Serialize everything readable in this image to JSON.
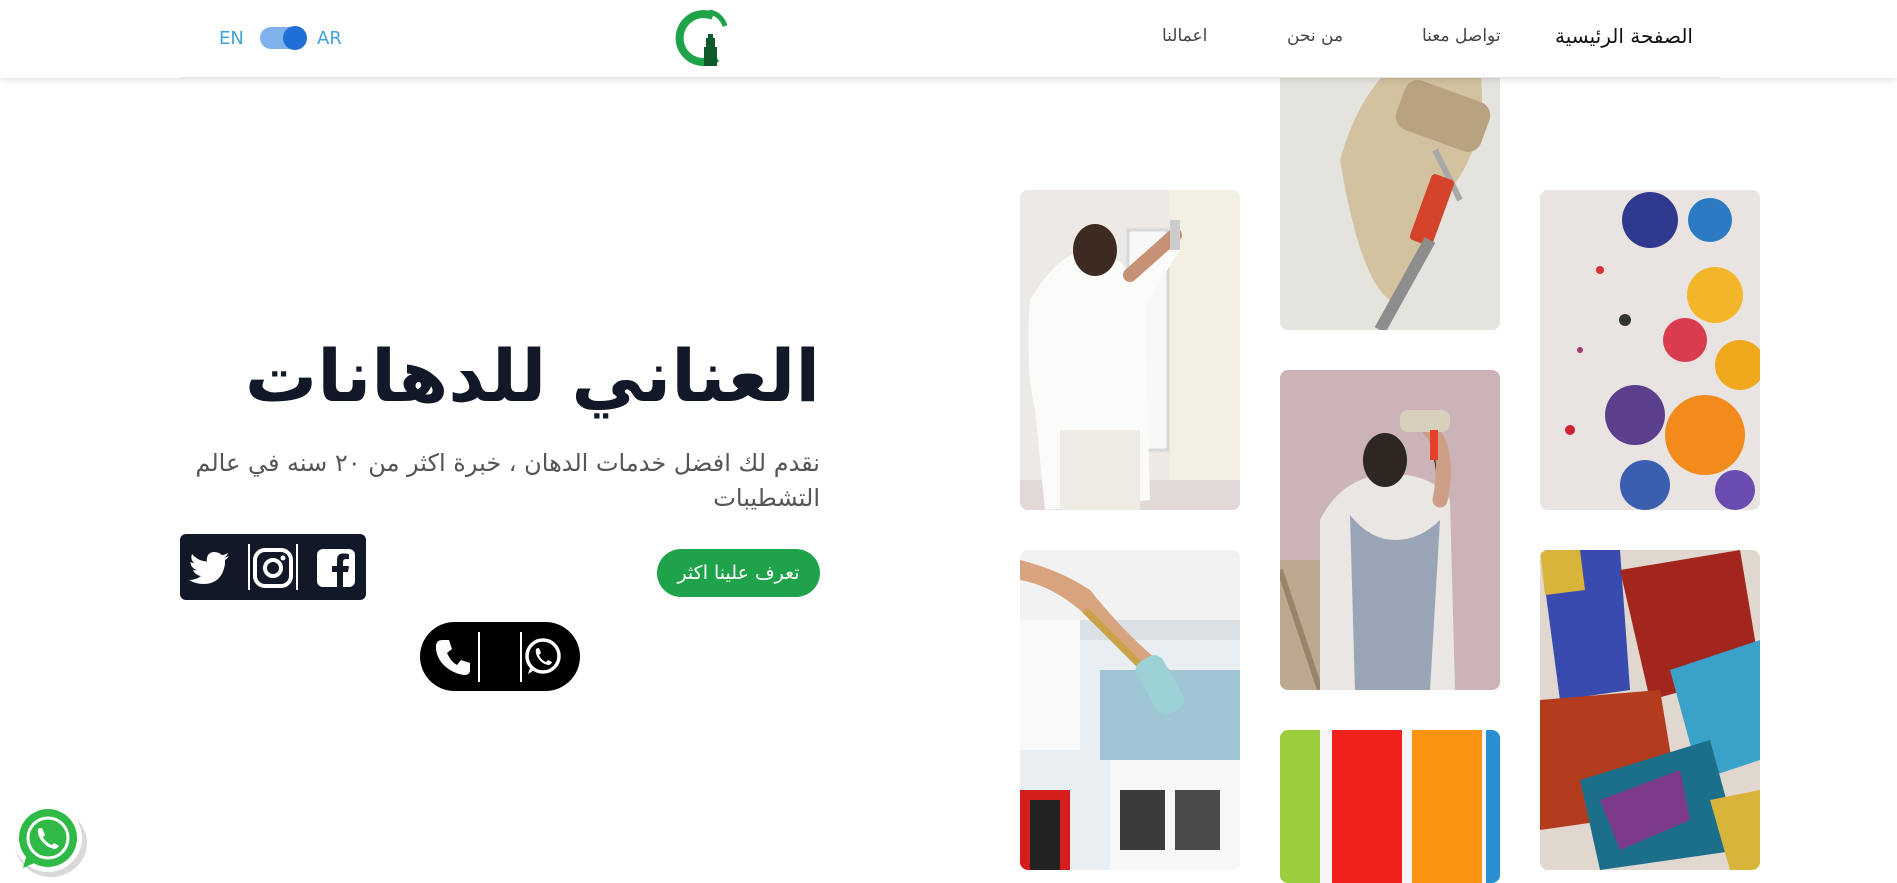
{
  "header": {
    "nav": [
      "الصفحة الرئيسية",
      "تواصل معنا",
      "من نحن",
      "اعمالنا"
    ],
    "lang_left": "EN",
    "lang_right": "AR"
  },
  "hero": {
    "title": "العناني للدهانات",
    "subtitle": "نقدم لك افضل خدمات الدهان ، خبرة اكثر من ٢٠ سنه في عالم التشطيبات",
    "cta_label": "تعرف علينا اكثر"
  },
  "social_icons": [
    "facebook-icon",
    "instagram-icon",
    "twitter-icon"
  ],
  "contact_icons": [
    "whatsapp-icon",
    "phone-icon"
  ],
  "colors": {
    "accent_green": "#1fa34a",
    "dark": "#111827",
    "lang_blue": "#3ba4dc",
    "toggle_blue": "#1f6fd6"
  },
  "gallery": [
    {
      "name": "painter-window-photo"
    },
    {
      "name": "roller-beige-photo"
    },
    {
      "name": "paint-cans-photo"
    },
    {
      "name": "painter-overalls-photo"
    },
    {
      "name": "painter-ceiling-photo"
    },
    {
      "name": "color-stripes-photo"
    },
    {
      "name": "paint-brushes-photo"
    }
  ]
}
